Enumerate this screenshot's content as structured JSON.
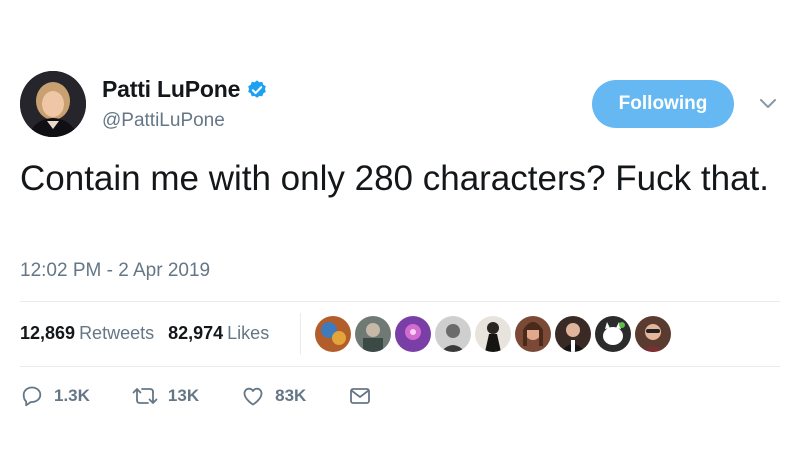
{
  "author": {
    "display_name": "Patti LuPone",
    "handle": "@PattiLuPone",
    "verified": true
  },
  "follow_button_label": "Following",
  "tweet": {
    "text": "Contain me with only 280 characters? Fuck that.",
    "timestamp": "12:02 PM - 2 Apr 2019"
  },
  "stats": {
    "retweets_count": "12,869",
    "retweets_label": "Retweets",
    "likes_count": "82,974",
    "likes_label": "Likes"
  },
  "actions": {
    "reply_count": "1.3K",
    "retweet_count": "13K",
    "like_count": "83K"
  },
  "colors": {
    "accent": "#66b8f3",
    "verified": "#1da1f2",
    "secondary_text": "#657786",
    "divider": "#e6ecf0"
  },
  "icons": [
    "verified-icon",
    "chevron-down-icon",
    "reply-icon",
    "retweet-icon",
    "heart-icon",
    "envelope-icon"
  ]
}
